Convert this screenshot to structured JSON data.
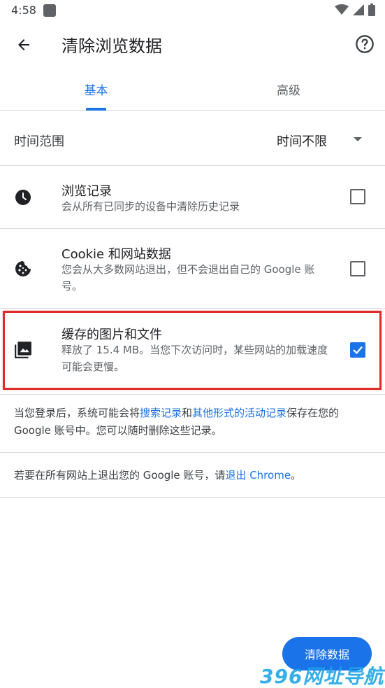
{
  "status_bar": {
    "time": "4:58"
  },
  "app_bar": {
    "title": "清除浏览数据"
  },
  "tabs": [
    {
      "label": "基本",
      "selected": true
    },
    {
      "label": "高级",
      "selected": false
    }
  ],
  "time_range": {
    "label": "时间范围",
    "value": "时间不限"
  },
  "items": [
    {
      "title": "浏览记录",
      "description": "会从所有已同步的设备中清除历史记录",
      "checked": false,
      "icon": "clock-icon"
    },
    {
      "title": "Cookie 和网站数据",
      "description": "您会从大多数网站退出，但不会退出自己的 Google 账号。",
      "checked": false,
      "icon": "cookie-icon"
    },
    {
      "title": "缓存的图片和文件",
      "description": "释放了 15.4 MB。当您下次访问时，某些网站的加载速度可能会更慢。",
      "checked": true,
      "icon": "image-icon"
    }
  ],
  "info1": {
    "prefix": "当您登录后，系统可能会将",
    "link1": "搜索记录",
    "middle": "和",
    "link2": "其他形式的活动记录",
    "suffix": "保存在您的 Google 账号中。您可以随时删除这些记录。"
  },
  "info2": {
    "prefix": "若要在所有网站上退出您的 Google 账号，请",
    "link": "退出 Chrome",
    "suffix": "。"
  },
  "clear_button": {
    "label": "清除数据"
  },
  "watermark": {
    "text": "396网址导航"
  },
  "colors": {
    "accent": "#1a73e8",
    "highlight": "#e02b2b",
    "divider": "#dadce0"
  }
}
